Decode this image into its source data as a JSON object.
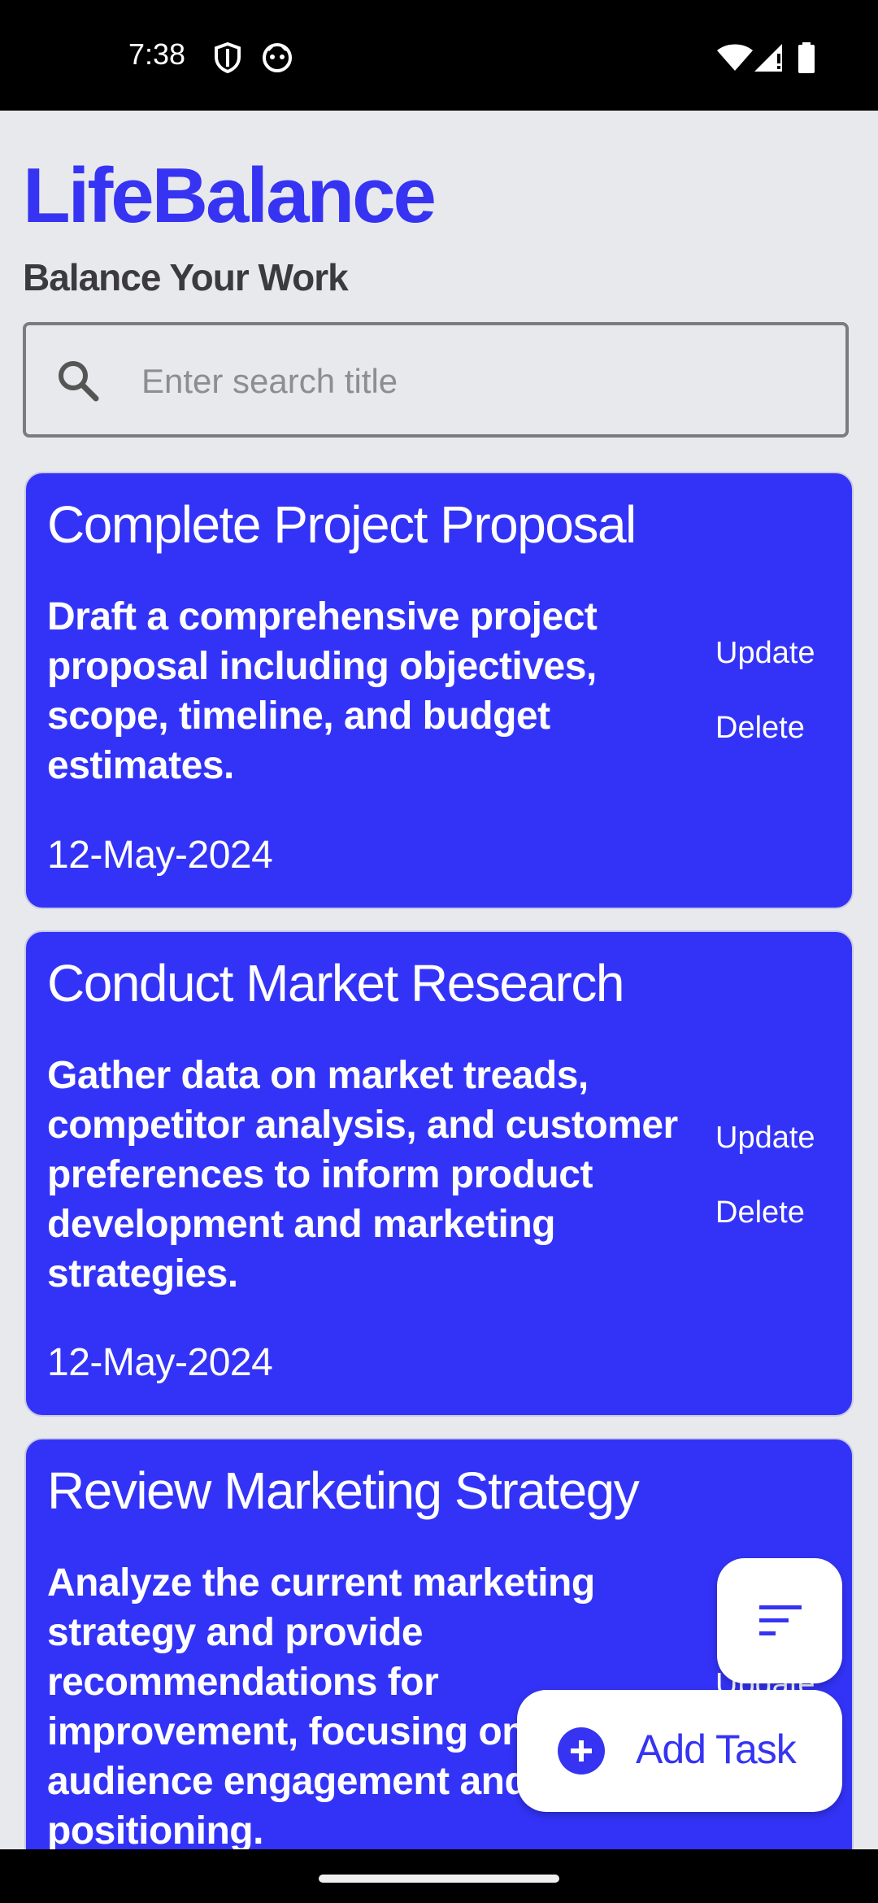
{
  "status_bar": {
    "time": "7:38"
  },
  "header": {
    "title": "LifeBalance",
    "subtitle": "Balance Your Work"
  },
  "search": {
    "placeholder": "Enter search title",
    "value": ""
  },
  "tasks": [
    {
      "title": "Complete Project Proposal",
      "description": "Draft a comprehensive project proposal including objectives, scope, timeline, and budget estimates.",
      "date": "12-May-2024",
      "update_label": "Update",
      "delete_label": "Delete"
    },
    {
      "title": "Conduct Market Research",
      "description": "Gather data on market treads, competitor analysis, and customer preferences to inform product development and marketing strategies.",
      "date": "12-May-2024",
      "update_label": "Update",
      "delete_label": "Delete"
    },
    {
      "title": "Review Marketing Strategy",
      "description": "Analyze the current marketing strategy and provide recommendations for improvement, focusing on audience engagement and positioning.",
      "update_label": "Update"
    }
  ],
  "fab": {
    "add_label": "Add Task"
  },
  "colors": {
    "accent": "#3634f2",
    "card": "#3333f8"
  }
}
